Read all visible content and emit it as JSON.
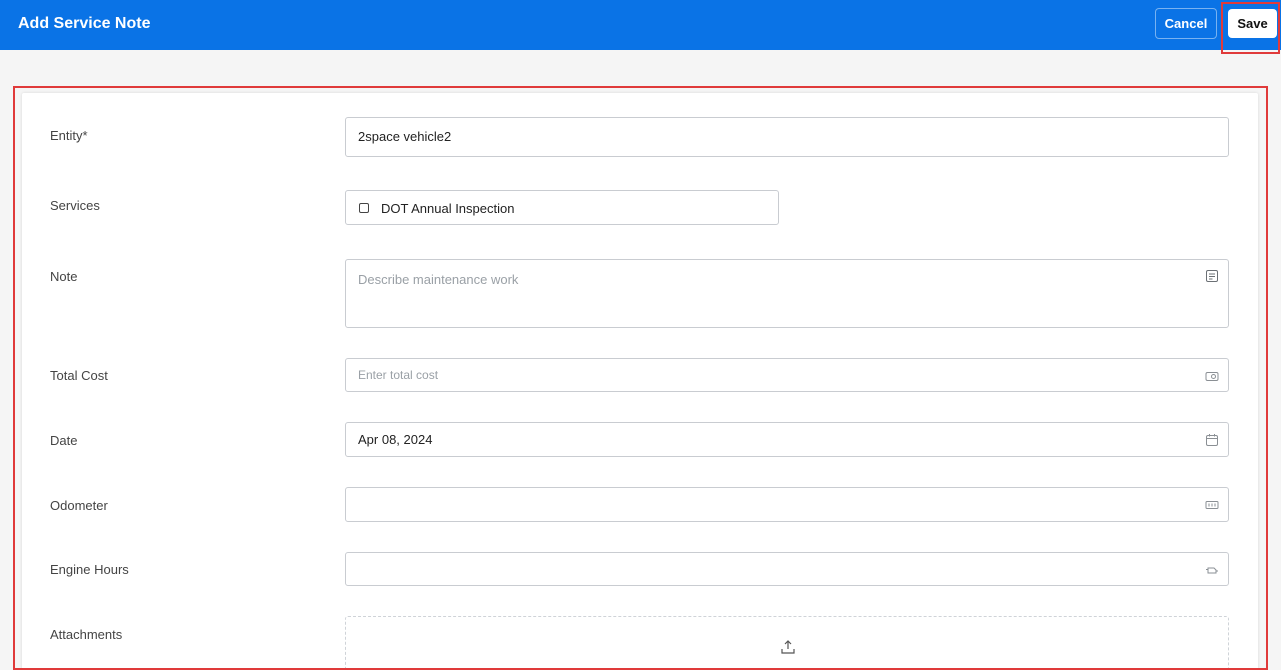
{
  "header": {
    "title": "Add Service Note",
    "cancel_label": "Cancel",
    "save_label": "Save"
  },
  "colors": {
    "header_bg": "#0a73e6",
    "highlight": "#e03a3a"
  },
  "form": {
    "entity": {
      "label": "Entity*",
      "value": "2space vehicle2"
    },
    "services": {
      "label": "Services",
      "option_label": "DOT Annual Inspection",
      "checked": false
    },
    "note": {
      "label": "Note",
      "placeholder": "Describe maintenance work",
      "icon": "note-icon"
    },
    "total_cost": {
      "label": "Total Cost",
      "placeholder": "Enter total cost",
      "icon": "money-icon"
    },
    "date": {
      "label": "Date",
      "value": "Apr 08, 2024",
      "icon": "calendar-icon"
    },
    "odometer": {
      "label": "Odometer",
      "value": "",
      "icon": "odometer-icon"
    },
    "engine_hours": {
      "label": "Engine Hours",
      "value": "",
      "icon": "engine-icon"
    },
    "attachments": {
      "label": "Attachments",
      "icon": "upload-icon"
    }
  }
}
